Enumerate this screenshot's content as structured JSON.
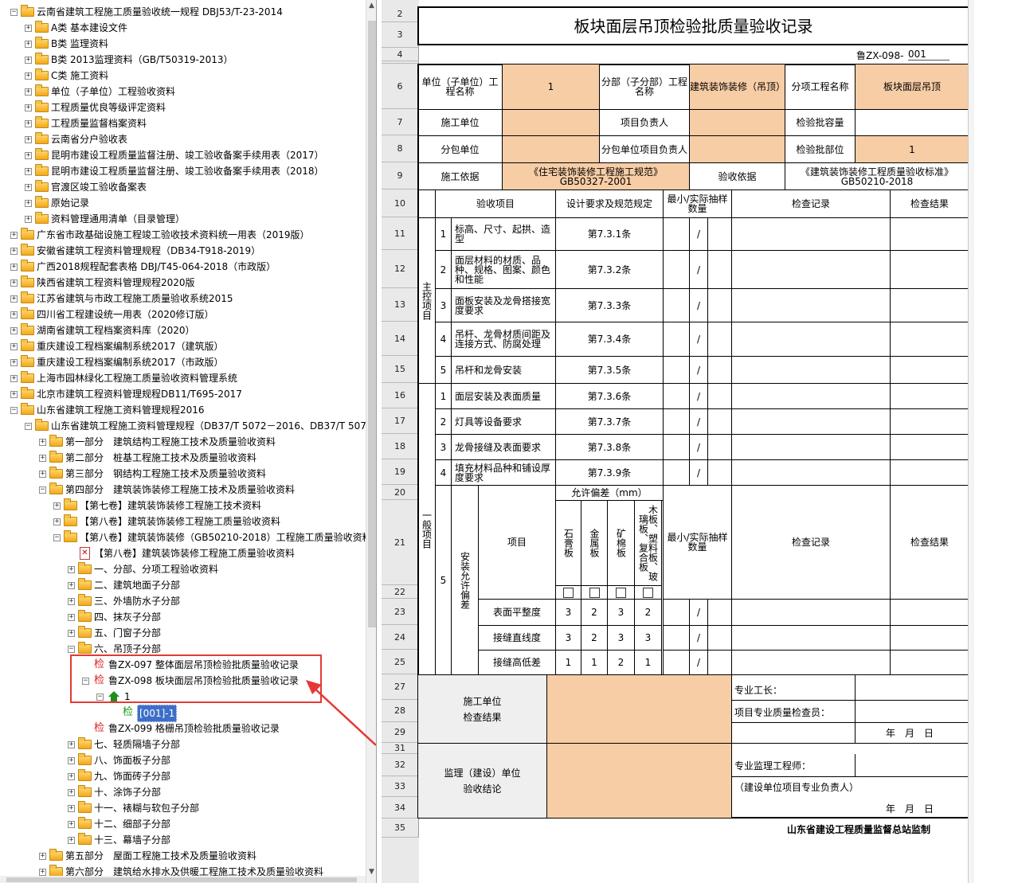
{
  "tree": {
    "items": [
      {
        "label": "云南省建筑工程施工质量验收统一规程 DBJ53/T-23-2014",
        "level": 1,
        "exp": "-"
      },
      {
        "label": "A类 基本建设文件",
        "level": 2,
        "exp": "+"
      },
      {
        "label": "B类 监理资料",
        "level": 2,
        "exp": "+"
      },
      {
        "label": "B类 2013监理资料（GB/T50319-2013）",
        "level": 2,
        "exp": "+"
      },
      {
        "label": "C类 施工资料",
        "level": 2,
        "exp": "+"
      },
      {
        "label": "单位（子单位）工程验收资料",
        "level": 2,
        "exp": "+"
      },
      {
        "label": "工程质量优良等级评定资料",
        "level": 2,
        "exp": "+"
      },
      {
        "label": "工程质量监督档案资料",
        "level": 2,
        "exp": "+"
      },
      {
        "label": "云南省分户验收表",
        "level": 2,
        "exp": "+"
      },
      {
        "label": "昆明市建设工程质量监督注册、竣工验收备案手续用表（2017）",
        "level": 2,
        "exp": "+"
      },
      {
        "label": "昆明市建设工程质量监督注册、竣工验收备案手续用表（2018）",
        "level": 2,
        "exp": "+"
      },
      {
        "label": "官渡区竣工验收备案表",
        "level": 2,
        "exp": "+"
      },
      {
        "label": "原始记录",
        "level": 2,
        "exp": "+"
      },
      {
        "label": "资料管理通用清单（目录管理）",
        "level": 2,
        "exp": "+"
      },
      {
        "label": "广东省市政基础设施工程竣工验收技术资料统一用表（2019版）",
        "level": 1,
        "exp": "+"
      },
      {
        "label": "安徽省建筑工程资料管理规程（DB34-T918-2019）",
        "level": 1,
        "exp": "+"
      },
      {
        "label": "广西2018规程配套表格 DBJ/T45-064-2018（市政版）",
        "level": 1,
        "exp": "+"
      },
      {
        "label": "陕西省建筑工程资料管理规程2020版",
        "level": 1,
        "exp": "+"
      },
      {
        "label": "江苏省建筑与市政工程施工质量验收系统2015",
        "level": 1,
        "exp": "+"
      },
      {
        "label": "四川省工程建设统一用表（2020修订版）",
        "level": 1,
        "exp": "+"
      },
      {
        "label": "湖南省建筑工程档案资料库（2020）",
        "level": 1,
        "exp": "+"
      },
      {
        "label": "重庆建设工程档案编制系统2017（建筑版）",
        "level": 1,
        "exp": "+"
      },
      {
        "label": "重庆建设工程档案编制系统2017（市政版）",
        "level": 1,
        "exp": "+"
      },
      {
        "label": "上海市园林绿化工程施工质量验收资料管理系统",
        "level": 1,
        "exp": "+"
      },
      {
        "label": "北京市建筑工程资料管理规程DB11/T695-2017",
        "level": 1,
        "exp": "+"
      },
      {
        "label": "山东省建筑工程施工资料管理规程2016",
        "level": 1,
        "exp": "-"
      },
      {
        "label": "山东省建筑工程施工资料管理规程（DB37/T 5072－2016、DB37/T 5073－2016）",
        "level": 2,
        "exp": "-"
      },
      {
        "label": "第一部分　建筑结构工程施工技术及质量验收资料",
        "level": 3,
        "exp": "+"
      },
      {
        "label": "第二部分　桩基工程施工技术及质量验收资料",
        "level": 3,
        "exp": "+"
      },
      {
        "label": "第三部分　钢结构工程施工技术及质量验收资料",
        "level": 3,
        "exp": "+"
      },
      {
        "label": "第四部分　建筑装饰装修工程施工技术及质量验收资料",
        "level": 3,
        "exp": "-"
      },
      {
        "label": "【第七卷】建筑装饰装修工程施工技术资料",
        "level": 4,
        "exp": "+"
      },
      {
        "label": "【第八卷】建筑装饰装修工程施工质量验收资料",
        "level": 4,
        "exp": "+"
      },
      {
        "label": "【第八卷】建筑装饰装修（GB50210-2018）工程施工质量验收资料",
        "level": 4,
        "exp": "-"
      },
      {
        "label": "【第八卷】建筑装饰装修工程施工质量验收资料",
        "level": 5,
        "exp": "",
        "icon": "pdf"
      },
      {
        "label": "一、分部、分项工程验收资料",
        "level": 5,
        "exp": "+"
      },
      {
        "label": "二、建筑地面子分部",
        "level": 5,
        "exp": "+"
      },
      {
        "label": "三、外墙防水子分部",
        "level": 5,
        "exp": "+"
      },
      {
        "label": "四、抹灰子分部",
        "level": 5,
        "exp": "+"
      },
      {
        "label": "五、门窗子分部",
        "level": 5,
        "exp": "+"
      },
      {
        "label": "六、吊顶子分部",
        "level": 5,
        "exp": "-"
      },
      {
        "label": "鲁ZX-097 整体面层吊顶检验批质量验收记录",
        "level": 6,
        "exp": "",
        "icon": "jian"
      },
      {
        "label": "鲁ZX-098 板块面层吊顶检验批质量验收记录",
        "level": 6,
        "exp": "-",
        "icon": "jian"
      },
      {
        "label": "1",
        "level": 7,
        "exp": "-",
        "icon": "home"
      },
      {
        "label": "[001]-1",
        "level": 8,
        "exp": "",
        "icon": "jian-green",
        "selected": true
      },
      {
        "label": "鲁ZX-099 格栅吊顶检验批质量验收记录",
        "level": 6,
        "exp": "",
        "icon": "jian"
      },
      {
        "label": "七、轻质隔墙子分部",
        "level": 5,
        "exp": "+"
      },
      {
        "label": "八、饰面板子分部",
        "level": 5,
        "exp": "+"
      },
      {
        "label": "九、饰面砖子分部",
        "level": 5,
        "exp": "+"
      },
      {
        "label": "十、涂饰子分部",
        "level": 5,
        "exp": "+"
      },
      {
        "label": "十一、裱糊与软包子分部",
        "level": 5,
        "exp": "+"
      },
      {
        "label": "十二、细部子分部",
        "level": 5,
        "exp": "+"
      },
      {
        "label": "十三、幕墙子分部",
        "level": 5,
        "exp": "+"
      },
      {
        "label": "第五部分　屋面工程施工技术及质量验收资料",
        "level": 3,
        "exp": "+"
      },
      {
        "label": "第六部分　建筑给水排水及供暖工程施工技术及质量验收资料",
        "level": 3,
        "exp": "+"
      }
    ],
    "jian_glyph": "检"
  },
  "rows": [
    "2",
    "3",
    "4",
    "",
    "6",
    "7",
    "8",
    "9",
    "10",
    "11",
    "12",
    "13",
    "14",
    "15",
    "16",
    "17",
    "18",
    "19",
    "20",
    "21",
    "22",
    "23",
    "24",
    "25",
    "27",
    "28",
    "29",
    "31",
    "32",
    "33",
    "34",
    "35"
  ],
  "form": {
    "title": "板块面层吊顶检验批质量验收记录",
    "code_prefix": "鲁ZX-098-",
    "code_value": "001",
    "unit_name_label": "单位（子单位）工程名称",
    "unit_name_value": "1",
    "subdiv_label": "分部（子分部）工程名称",
    "subdiv_value": "建筑装饰装修（吊顶）",
    "item_label": "分项工程名称",
    "item_value": "板块面层吊顶",
    "contractor_label": "施工单位",
    "pm_label": "项目负责人",
    "capacity_label": "检验批容量",
    "subcontractor_label": "分包单位",
    "sub_pm_label": "分包单位项目负责人",
    "part_label": "检验批部位",
    "part_value": "1",
    "basis_label": "施工依据",
    "basis_value1": "《住宅装饰装修工程施工规范》",
    "basis_value2": "GB50327-2001",
    "acc_basis_label": "验收依据",
    "acc_basis_value1": "《建筑装饰装修工程质量验收标准》",
    "acc_basis_value2": "GB50210-2018",
    "hdr_item": "验收项目",
    "hdr_design": "设计要求及规范规定",
    "hdr_sample": "最小/实际抽样数量",
    "hdr_record": "检查记录",
    "hdr_result": "检查结果",
    "main_label": "主控项目",
    "general_label": "一般项目",
    "main_items": [
      {
        "n": "1",
        "text": "标高、尺寸、起拱、造型",
        "spec": "第7.3.1条"
      },
      {
        "n": "2",
        "text": "面层材料的材质、品种、规格、图案、颜色和性能",
        "spec": "第7.3.2条"
      },
      {
        "n": "3",
        "text": "面板安装及龙骨搭接宽度要求",
        "spec": "第7.3.3条"
      },
      {
        "n": "4",
        "text": "吊杆、龙骨材质间距及连接方式、防腐处理",
        "spec": "第7.3.4条"
      },
      {
        "n": "5",
        "text": "吊杆和龙骨安装",
        "spec": "第7.3.5条"
      }
    ],
    "general_items": [
      {
        "n": "1",
        "text": "面层安装及表面质量",
        "spec": "第7.3.6条"
      },
      {
        "n": "2",
        "text": "灯具等设备要求",
        "spec": "第7.3.7条"
      },
      {
        "n": "3",
        "text": "龙骨接缝及表面要求",
        "spec": "第7.3.8条"
      },
      {
        "n": "4",
        "text": "填充材料品种和铺设厚度要求",
        "spec": "第7.3.9条"
      }
    ],
    "slash": "/",
    "g5_n": "5",
    "g5_label": "安装允许偏差",
    "allow_dev": "允许偏差（mm）",
    "g5_item_label": "项目",
    "dev_cols": [
      "石膏板",
      "金属板",
      "矿棉板",
      "木板、塑料板、玻璃板、复合板"
    ],
    "dev_rows": [
      {
        "name": "表面平整度",
        "vals": [
          "3",
          "2",
          "3",
          "2"
        ]
      },
      {
        "name": "接缝直线度",
        "vals": [
          "3",
          "2",
          "3",
          "3"
        ]
      },
      {
        "name": "接缝高低差",
        "vals": [
          "1",
          "1",
          "2",
          "1"
        ]
      }
    ],
    "check_label1": "施工单位",
    "check_label2": "检查结果",
    "foreman_label": "专业工长：",
    "qc_label": "项目专业质量检查员：",
    "date_label": "年　月　日",
    "sup_label1": "监理（建设）单位",
    "sup_label2": "验收结论",
    "sup_eng_label": "专业监理工程师：",
    "sup_owner_label": "（建设单位项目专业负责人）",
    "footer": "山东省建设工程质量监督总站监制"
  },
  "colors": {
    "tan": "#f7cda6",
    "highlight": "#e53935",
    "selection": "#3d6fc9"
  }
}
